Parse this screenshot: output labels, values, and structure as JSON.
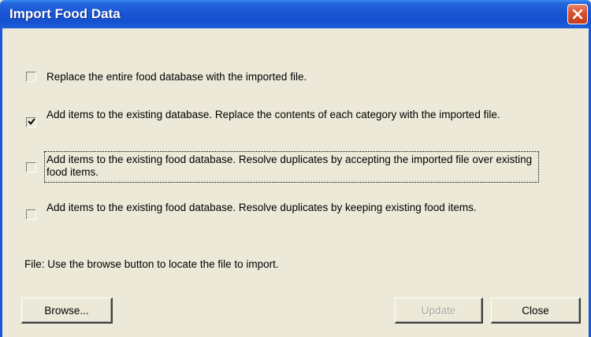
{
  "window": {
    "title": "Import Food Data"
  },
  "options": [
    {
      "label": "Replace the entire food database with the imported file.",
      "checked": false
    },
    {
      "label": "Add items to the existing database.  Replace the contents of each category with the imported file.",
      "checked": true
    },
    {
      "label": "Add items to the existing food database.  Resolve duplicates by accepting the imported file over existing food items.",
      "checked": false,
      "focused": true
    },
    {
      "label": "Add items to the existing food database.  Resolve duplicates by keeping existing food items.",
      "checked": false
    }
  ],
  "file": {
    "status_text": "File: Use the browse button to locate the file to import."
  },
  "buttons": {
    "browse": "Browse...",
    "update": "Update",
    "close": "Close"
  },
  "colors": {
    "title_bar": "#1a56d4",
    "dialog_background": "#ece9d8",
    "close_button": "#d9532f",
    "disabled_text": "#a7a695"
  },
  "icons": {
    "close": "close-x-icon",
    "checkmark": "checkmark-icon"
  }
}
